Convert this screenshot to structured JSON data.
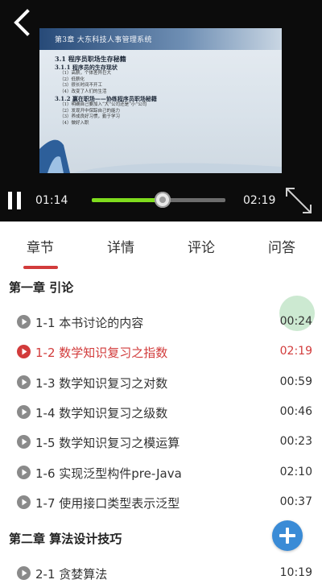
{
  "player": {
    "slide": {
      "header": "第3章 大东科技人事管理系统",
      "lines": [
        {
          "cls": "sl-h1",
          "text": "3.1 程序员职场生存秘籍"
        },
        {
          "cls": "sl-h2",
          "text": "3.1.1 程序员的生存现状"
        },
        {
          "cls": "sl-li",
          "text": "（1）高薪，个体差异巨大"
        },
        {
          "cls": "sl-li",
          "text": "（2）低薪化"
        },
        {
          "cls": "sl-li",
          "text": "（3）很长时间不开工"
        },
        {
          "cls": "sl-li",
          "text": "（4）改变了人们的生活"
        },
        {
          "cls": "sl-h2",
          "text": "3.1.2 赢在职场——协练程序员职场秘籍"
        },
        {
          "cls": "sl-li",
          "text": "（1）明确自己要加入“大”公司还是“小”公司"
        },
        {
          "cls": "sl-li",
          "text": "（2）发现开中保踪自己的能力"
        },
        {
          "cls": "sl-li",
          "text": "（3）养成良好习惯，勤于学习"
        },
        {
          "cls": "sl-li",
          "text": "（4）做好入职"
        }
      ]
    },
    "current_time": "01:14",
    "total_time": "02:19",
    "progress": 0.53,
    "colors": {
      "progress": "#7fdc1d",
      "accent": "#d23b3b",
      "fab": "#3a8bd6"
    }
  },
  "tabs": [
    {
      "label": "章节",
      "selected": true
    },
    {
      "label": "详情",
      "selected": false
    },
    {
      "label": "评论",
      "selected": false
    },
    {
      "label": "问答",
      "selected": false
    }
  ],
  "chapters": [
    {
      "title": "第一章 引论",
      "lessons": [
        {
          "label": "1-1 本书讨论的内容",
          "time": "00:24",
          "active": false
        },
        {
          "label": "1-2 数学知识复习之指数",
          "time": "02:19",
          "active": true
        },
        {
          "label": "1-3 数学知识复习之对数",
          "time": "00:59",
          "active": false
        },
        {
          "label": "1-4 数学知识复习之级数",
          "time": "00:46",
          "active": false
        },
        {
          "label": "1-5 数学知识复习之模运算",
          "time": "00:23",
          "active": false
        },
        {
          "label": "1-6 实现泛型构件pre-Java",
          "time": "02:10",
          "active": false
        },
        {
          "label": "1-7 使用接口类型表示泛型",
          "time": "00:37",
          "active": false
        }
      ]
    },
    {
      "title": "第二章 算法设计技巧",
      "lessons": [
        {
          "label": "2-1 贪婪算法",
          "time": "10:19",
          "active": false
        }
      ]
    }
  ],
  "icons": {
    "back": "back-arrow-icon",
    "pause": "pause-icon",
    "fullscreen": "fullscreen-icon",
    "lesson": "play-circle-icon",
    "fab": "plus-icon"
  }
}
